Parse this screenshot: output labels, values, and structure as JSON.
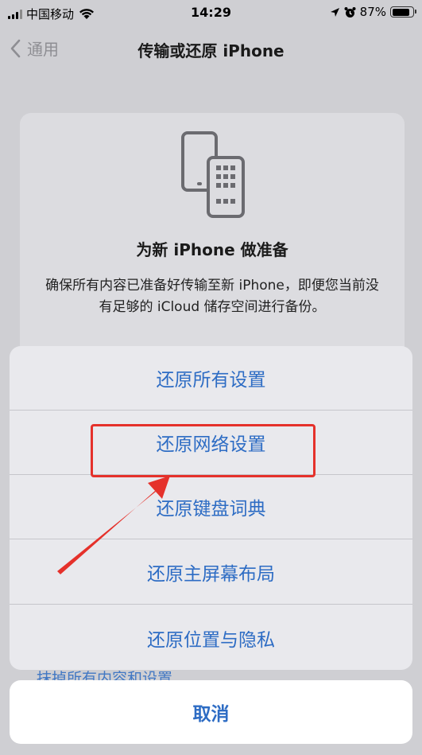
{
  "status_bar": {
    "carrier": "中国移动",
    "time": "14:29",
    "battery": "87%",
    "battery_level": 0.87
  },
  "nav": {
    "back_label": "通用",
    "title": "传输或还原 iPhone"
  },
  "prepare_card": {
    "icon": "two-phones-icon",
    "title": "为新 iPhone 做准备",
    "description": "确保所有内容已准备好传输至新 iPhone，即便您当前没有足够的 iCloud 储存空间进行备份。"
  },
  "peek_text": "抹掉所有内容和设置",
  "action_sheet": {
    "items": [
      {
        "label": "还原所有设置"
      },
      {
        "label": "还原网络设置"
      },
      {
        "label": "还原键盘词典"
      },
      {
        "label": "还原主屏幕布局"
      },
      {
        "label": "还原位置与隐私"
      }
    ],
    "cancel_label": "取消"
  },
  "colors": {
    "action_blue": "#2d6cc4",
    "annotation_red": "#e5312b",
    "dim_background": "#cfcfd3"
  }
}
